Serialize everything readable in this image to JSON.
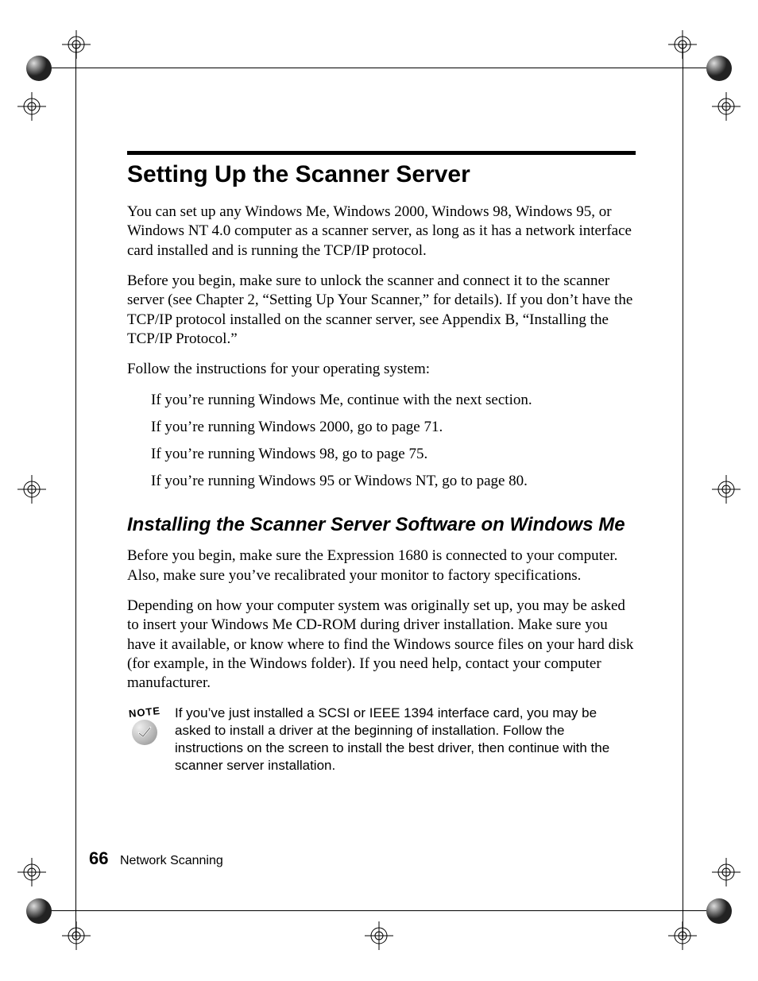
{
  "heading": "Setting Up the Scanner Server",
  "para1": "You can set up any Windows Me, Windows 2000, Windows 98, Windows 95, or Windows NT 4.0 computer as a scanner server, as long as it has a network interface card installed and is running the TCP/IP protocol.",
  "para2": "Before you begin, make sure to unlock the scanner and connect it to the scanner server (see Chapter 2, “Setting Up Your Scanner,” for details). If you don’t have the TCP/IP protocol installed on the scanner server, see Appendix B, “Installing the TCP/IP Protocol.”",
  "para3": "Follow the instructions for your operating system:",
  "bullets": [
    "If you’re running Windows Me, continue with the next section.",
    "If you’re running Windows 2000, go to page 71.",
    "If you’re running Windows 98, go to page 75.",
    "If you’re running Windows 95 or Windows NT, go to page 80."
  ],
  "subheading": "Installing the Scanner Server Software on Windows Me",
  "para4": "Before you begin, make sure the Expression 1680 is connected to your computer. Also, make sure you’ve recalibrated your monitor to factory specifications.",
  "para5": "Depending on how your computer system was originally set up, you may be asked to insert your Windows Me CD-ROM during driver installation. Make sure you have it available, or know where to find the Windows source files on your hard disk (for example, in the Windows folder). If you need help, contact your computer manufacturer.",
  "note_label": "NOTE",
  "note_text": "If you’ve just installed a SCSI or IEEE 1394 interface card, you may be asked to install a driver at the beginning of installation. Follow the instructions on the screen to install the best driver, then continue with the scanner server installation.",
  "footer_num": "66",
  "footer_text": "Network Scanning"
}
